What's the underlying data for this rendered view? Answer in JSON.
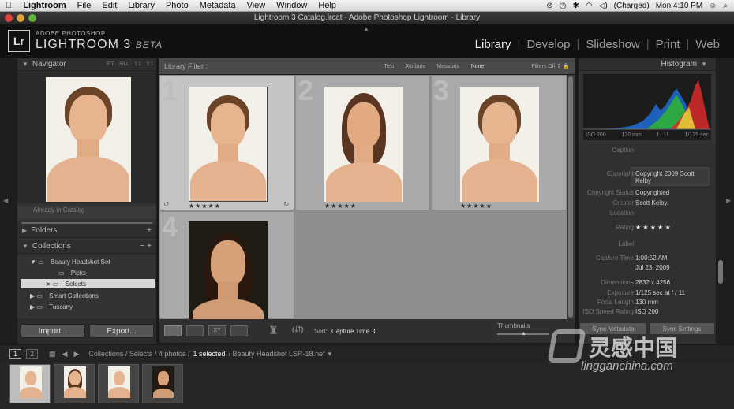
{
  "menubar": {
    "apple": "",
    "app": "Lightroom",
    "items": [
      "File",
      "Edit",
      "Library",
      "Photo",
      "Metadata",
      "View",
      "Window",
      "Help"
    ],
    "charged": "(Charged)",
    "clock": "Mon 4:10 PM"
  },
  "window": {
    "title": "Lightroom 3 Catalog.lrcat - Adobe Photoshop Lightroom - Library"
  },
  "identity": {
    "logo": "Lr",
    "line1": "ADOBE PHOTOSHOP",
    "line2": "LIGHTROOM 3",
    "beta": "BETA"
  },
  "modules": [
    "Library",
    "Develop",
    "Slideshow",
    "Print",
    "Web"
  ],
  "navigator": {
    "title": "Navigator",
    "zoom": [
      "FIT",
      "FILL",
      "1:1",
      "3:1"
    ]
  },
  "left": {
    "catalog_item": "Already in Catalog",
    "folders": "Folders",
    "collections": "Collections",
    "collection_items": [
      "Beauty Headshot Set",
      "Picks",
      "Selects",
      "Smart Collections",
      "Tuscany"
    ],
    "import": "Import...",
    "export": "Export..."
  },
  "filter": {
    "label": "Library Filter :",
    "tabs": [
      "Text",
      "Attribute",
      "Metadata",
      "None"
    ],
    "filters_off": "Filters Off"
  },
  "grid": {
    "cells": [
      {
        "num": "1",
        "stars": "★★★★★"
      },
      {
        "num": "2",
        "stars": "★★★★★"
      },
      {
        "num": "3",
        "stars": "★★★★★"
      },
      {
        "num": "4",
        "stars": ""
      }
    ]
  },
  "toolbar": {
    "sort_label": "Sort:",
    "sort_value": "Capture Time",
    "thumbnails": "Thumbnails"
  },
  "histogram": {
    "title": "Histogram",
    "iso": "ISO 200",
    "focal": "130 mm",
    "fstop": "f / 11",
    "shutter": "1/125 sec"
  },
  "metadata": {
    "rows": [
      {
        "k": "Caption",
        "v": ""
      },
      {
        "k": "Copyright",
        "v": "Copyright 2009 Scott Kelby"
      },
      {
        "k": "Copyright Status",
        "v": "Copyrighted"
      },
      {
        "k": "Creator",
        "v": "Scott Kelby"
      },
      {
        "k": "Location",
        "v": ""
      },
      {
        "k": "Rating",
        "v": "★ ★ ★ ★ ★"
      },
      {
        "k": "Label",
        "v": ""
      },
      {
        "k": "Capture Time",
        "v": "1:00:52 AM"
      },
      {
        "k": "",
        "v": "Jul 23, 2009"
      },
      {
        "k": "Dimensions",
        "v": "2832 x 4256"
      },
      {
        "k": "Exposure",
        "v": "1/125 sec at f / 11"
      },
      {
        "k": "Focal Length",
        "v": "130 mm"
      },
      {
        "k": "ISO Speed Rating",
        "v": "ISO 200"
      }
    ],
    "sync_meta": "Sync Metadata",
    "sync_settings": "Sync Settings"
  },
  "breadcrumb": {
    "pages": [
      "1",
      "2"
    ],
    "path": "Collections / Selects / 4 photos /",
    "selected": "1 selected",
    "file": "/ Beauty Headshot LSR-18.nef"
  },
  "watermark": {
    "cn": "灵感中国",
    "url": "lingganchina.com"
  },
  "colors": {
    "panel": "#333333",
    "grid": "#a9a9a9",
    "selected": "#c4c4c4",
    "bg": "#1a1a1a"
  }
}
